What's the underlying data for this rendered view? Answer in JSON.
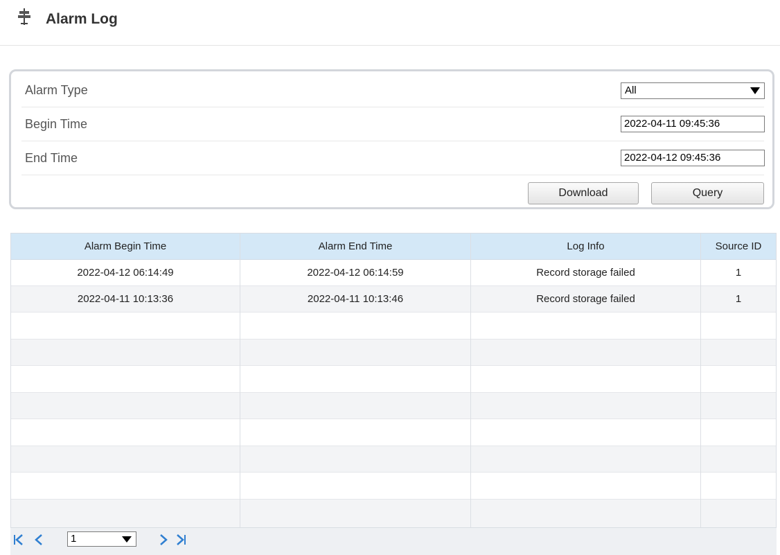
{
  "page": {
    "title": "Alarm Log",
    "title_icon": "signpost-icon"
  },
  "filters": {
    "alarm_type": {
      "label": "Alarm Type",
      "value": "All"
    },
    "begin_time": {
      "label": "Begin Time",
      "value": "2022-04-11 09:45:36"
    },
    "end_time": {
      "label": "End Time",
      "value": "2022-04-12 09:45:36"
    },
    "download_label": "Download",
    "query_label": "Query"
  },
  "table": {
    "columns": [
      "Alarm Begin Time",
      "Alarm End Time",
      "Log Info",
      "Source ID"
    ],
    "rows": [
      [
        "2022-04-12 06:14:49",
        "2022-04-12 06:14:59",
        "Record storage failed",
        "1"
      ],
      [
        "2022-04-11 10:13:36",
        "2022-04-11 10:13:46",
        "Record storage failed",
        "1"
      ]
    ],
    "empty_rows": 8
  },
  "pager": {
    "page_value": "1",
    "icons": {
      "first": "first-page-icon",
      "prev": "prev-page-icon",
      "next": "next-page-icon",
      "last": "last-page-icon"
    },
    "accent": "#2f7fd1"
  },
  "colors": {
    "header_bg": "#d4e8f7",
    "row_alt_bg": "#f3f4f6",
    "panel_border": "#d3d6db"
  }
}
